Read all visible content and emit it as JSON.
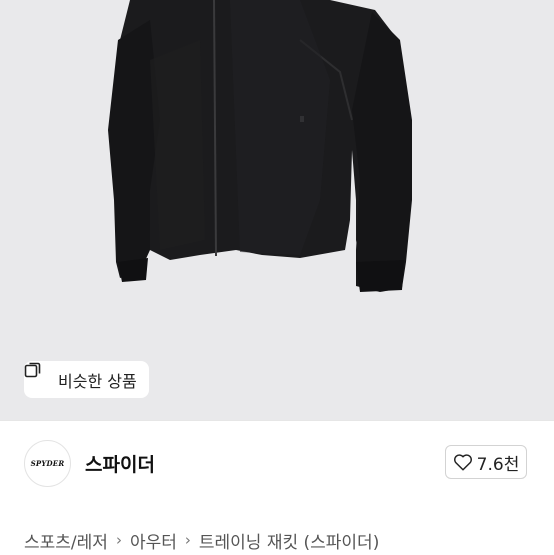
{
  "hero": {
    "similar_button_label": "비슷한 상품",
    "image_subject": "black zip-up training jacket"
  },
  "brand": {
    "logo_text": "SPYDER",
    "name": "스파이더"
  },
  "like": {
    "count": "7.6천",
    "icon": "heart-outline-icon"
  },
  "breadcrumb": {
    "items": [
      "스포츠/레저",
      "아우터",
      "트레이닝 재킷 (스파이더)"
    ]
  },
  "colors": {
    "hero_background": "#e9e9eb",
    "jacket": "#1a1a1c"
  }
}
